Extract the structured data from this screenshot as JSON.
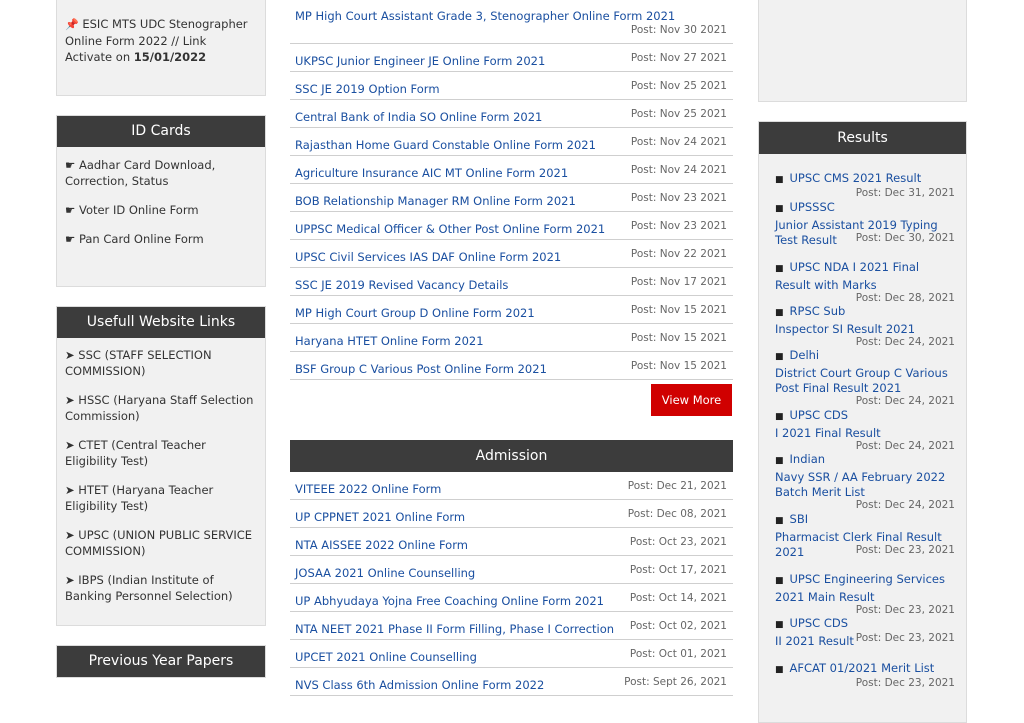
{
  "left": {
    "notice": {
      "pin": "📌",
      "text": "ESIC MTS UDC Stenographer Online Form 2022 // Link Activate on ",
      "bold": "15/01/2022"
    },
    "id_cards": {
      "title": "ID Cards",
      "items": [
        "☛ Aadhar Card Download, Correction, Status",
        "☛ Voter ID Online Form",
        "☛ Pan Card Online Form"
      ]
    },
    "useful": {
      "title": "Usefull Website Links",
      "items": [
        "➤ SSC (STAFF SELECTION COMMISSION)",
        "➤ HSSC (Haryana Staff Selection Commission)",
        "➤ CTET (Central Teacher Eligibility Test)",
        "➤ HTET (Haryana Teacher Eligibility Test)",
        "➤ UPSC (UNION PUBLIC SERVICE COMMISSION)",
        "➤ IBPS (Indian Institute of Banking Personnel Selection)"
      ]
    },
    "prev_title": "Previous Year Papers"
  },
  "jobs": [
    {
      "title": "MP High Court Assistant Grade 3, Stenographer Online Form 2021",
      "post": "Post: Nov 30 2021"
    },
    {
      "title": "UKPSC Junior Engineer JE Online Form 2021",
      "post": "Post: Nov 27 2021"
    },
    {
      "title": "SSC JE 2019 Option Form",
      "post": "Post: Nov 25 2021"
    },
    {
      "title": "Central Bank of India SO Online Form 2021",
      "post": "Post: Nov 25 2021"
    },
    {
      "title": "Rajasthan Home Guard Constable Online Form 2021",
      "post": "Post: Nov 24 2021"
    },
    {
      "title": "Agriculture Insurance AIC MT Online Form 2021",
      "post": "Post: Nov 24 2021"
    },
    {
      "title": "BOB Relationship Manager RM Online Form 2021",
      "post": "Post: Nov 23 2021"
    },
    {
      "title": "UPPSC Medical Officer & Other Post Online Form 2021",
      "post": "Post: Nov 23 2021"
    },
    {
      "title": "UPSC Civil Services IAS DAF Online Form 2021",
      "post": "Post: Nov 22 2021"
    },
    {
      "title": "SSC JE 2019 Revised Vacancy Details",
      "post": "Post: Nov 17 2021"
    },
    {
      "title": "MP High Court Group D Online Form 2021",
      "post": "Post: Nov 15 2021"
    },
    {
      "title": "Haryana HTET Online Form 2021",
      "post": "Post: Nov 15 2021"
    },
    {
      "title": "BSF Group C Various Post Online Form 2021",
      "post": "Post: Nov 15 2021"
    }
  ],
  "view_more": "View More",
  "admission": {
    "title": "Admission",
    "items": [
      {
        "title": "VITEEE 2022 Online Form",
        "post": "Post: Dec 21, 2021"
      },
      {
        "title": "UP CPPNET 2021 Online Form",
        "post": "Post: Dec 08, 2021"
      },
      {
        "title": "NTA AISSEE 2022 Online Form",
        "post": "Post: Oct 23, 2021"
      },
      {
        "title": "JOSAA 2021 Online Counselling",
        "post": "Post: Oct 17, 2021"
      },
      {
        "title": "UP Abhyudaya Yojna Free Coaching Online Form 2021",
        "post": "Post: Oct 14, 2021"
      },
      {
        "title": "NTA NEET 2021 Phase II Form Filling, Phase I Correction",
        "post": "Post: Oct 02, 2021"
      },
      {
        "title": "UPCET 2021 Online Counselling",
        "post": "Post: Oct 01, 2021"
      },
      {
        "title": "NVS Class 6th Admission Online Form 2022",
        "post": "Post: Sept 26, 2021"
      }
    ]
  },
  "results": {
    "title": "Results",
    "items": [
      {
        "l1": "UPSC CMS 2021 Result",
        "post": "Post: Dec 31, 2021"
      },
      {
        "l1": "UPSSSC",
        "l2": "Junior Assistant 2019 Typing",
        "l3": "Test Result",
        "post": "Post: Dec 30, 2021"
      },
      {
        "l1": "UPSC NDA I 2021 Final",
        "l2": "Result with Marks",
        "post": "Post: Dec 28, 2021"
      },
      {
        "l1": "RPSC Sub",
        "l2": "Inspector SI Result 2021",
        "post": "Post: Dec 24, 2021"
      },
      {
        "l1": "Delhi",
        "l2": "District Court Group C Various",
        "l3": "Post Final Result 2021",
        "post": "Post: Dec 24, 2021"
      },
      {
        "l1": "UPSC CDS",
        "l2": "I 2021 Final Result",
        "post": "Post: Dec 24, 2021"
      },
      {
        "l1": "Indian",
        "l2": "Navy SSR / AA February 2022",
        "l3": "Batch Merit List",
        "post": "Post: Dec 24, 2021"
      },
      {
        "l1": "SBI",
        "l2": "Pharmacist Clerk Final Result",
        "l3": "2021",
        "post": "Post: Dec 23, 2021"
      },
      {
        "l1": "UPSC Engineering Services",
        "l2": "2021 Main Result",
        "post": "Post: Dec 23, 2021"
      },
      {
        "l1": "UPSC CDS",
        "l2": "II 2021 Result",
        "post": "Post: Dec 23, 2021"
      },
      {
        "l1": "AFCAT 01/2021 Merit List",
        "post": "Post: Dec 23, 2021"
      }
    ]
  }
}
